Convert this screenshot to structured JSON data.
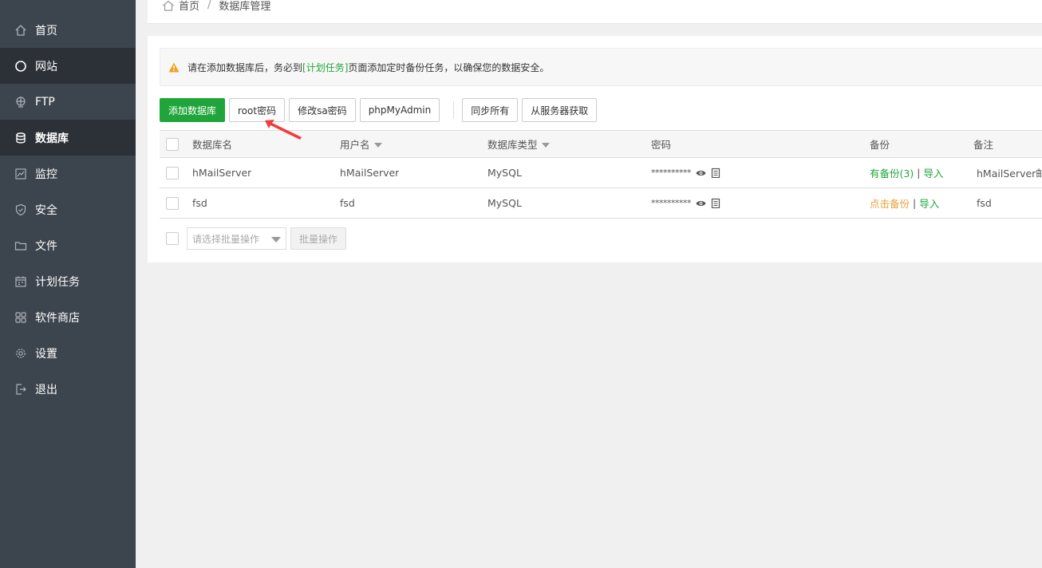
{
  "sidebar": {
    "items": [
      {
        "label": "首页",
        "icon": "home-icon"
      },
      {
        "label": "网站",
        "icon": "globe-icon"
      },
      {
        "label": "FTP",
        "icon": "ftp-icon"
      },
      {
        "label": "数据库",
        "icon": "database-icon"
      },
      {
        "label": "监控",
        "icon": "monitor-icon"
      },
      {
        "label": "安全",
        "icon": "shield-icon"
      },
      {
        "label": "文件",
        "icon": "folder-icon"
      },
      {
        "label": "计划任务",
        "icon": "calendar-icon"
      },
      {
        "label": "软件商店",
        "icon": "apps-grid-icon"
      },
      {
        "label": "设置",
        "icon": "gear-icon"
      },
      {
        "label": "退出",
        "icon": "logout-icon"
      }
    ]
  },
  "breadcrumb": {
    "home": "首页",
    "sep": "/",
    "current": "数据库管理"
  },
  "alert": {
    "prefix": "请在添加数据库后，务必到",
    "link": "[计划任务]",
    "suffix": "页面添加定时备份任务，以确保您的数据安全。"
  },
  "toolbar": {
    "add": "添加数据库",
    "root_pwd": "root密码",
    "sa_pwd": "修改sa密码",
    "phpmyadmin": "phpMyAdmin",
    "sync_all": "同步所有",
    "fetch_server": "从服务器获取"
  },
  "table": {
    "headers": {
      "name": "数据库名",
      "user": "用户名",
      "type": "数据库类型",
      "password": "密码",
      "backup": "备份",
      "note": "备注"
    },
    "rows": [
      {
        "name": "hMailServer",
        "user": "hMailServer",
        "type": "MySQL",
        "password": "**********",
        "backup": "有备份(3)",
        "backup_sep": "|",
        "import": "导入",
        "note": "hMailServer邮件"
      },
      {
        "name": "fsd",
        "user": "fsd",
        "type": "MySQL",
        "password": "**********",
        "backup": "点击备份",
        "backup_sep": "|",
        "import": "导入",
        "note": "fsd"
      }
    ]
  },
  "batch": {
    "placeholder": "请选择批量操作",
    "button": "批量操作"
  },
  "colors": {
    "sidebar_bg": "#3c444d",
    "sidebar_active": "#2c3138",
    "primary": "#20a53a",
    "orange": "#e6a23c",
    "annotation_arrow": "#f03c3c"
  }
}
